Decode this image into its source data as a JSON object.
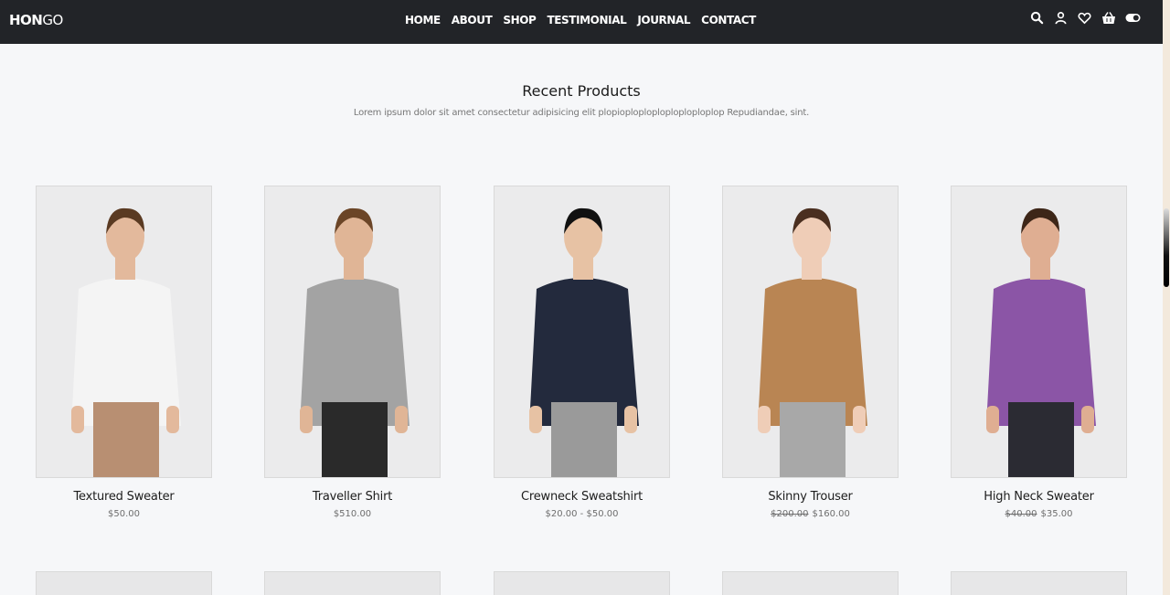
{
  "brand": {
    "bold": "HON",
    "light": "GO"
  },
  "nav": [
    "HOME",
    "ABOUT",
    "SHOP",
    "TESTIMONIAL",
    "JOURNAL",
    "CONTACT"
  ],
  "icons": [
    "search-icon",
    "user-icon",
    "heart-icon",
    "basket-icon",
    "toggle-icon"
  ],
  "section": {
    "title": "Recent Products",
    "subtitle": "Lorem ipsum dolor sit amet consectetur adipisicing elit plopioploploploploploploplop Repudiandae, sint."
  },
  "products": [
    {
      "name": "Textured Sweater",
      "old_price": "",
      "price": "$50.00",
      "top_color": "#f4f4f4",
      "bottom_color": "#b88f72",
      "skin": "#e3b99c",
      "hair": "#5a3a22"
    },
    {
      "name": "Traveller Shirt",
      "old_price": "",
      "price": "$510.00",
      "top_color": "#a3a3a3",
      "bottom_color": "#2a2a2a",
      "skin": "#e0b596",
      "hair": "#6b4527"
    },
    {
      "name": "Crewneck Sweatshirt",
      "old_price": "",
      "price": "$20.00 - $50.00",
      "top_color": "#232a3d",
      "bottom_color": "#9a9a9a",
      "skin": "#e7c2a4",
      "hair": "#111111"
    },
    {
      "name": "Skinny Trouser",
      "old_price": "$200.00",
      "price": "$160.00",
      "top_color": "#b98553",
      "bottom_color": "#a8a8a8",
      "skin": "#efcdb7",
      "hair": "#4a2f20"
    },
    {
      "name": "High Neck Sweater",
      "old_price": "$40.00",
      "price": "$35.00",
      "top_color": "#8b55a6",
      "bottom_color": "#2b2b33",
      "skin": "#dfae92",
      "hair": "#3d2618"
    }
  ]
}
